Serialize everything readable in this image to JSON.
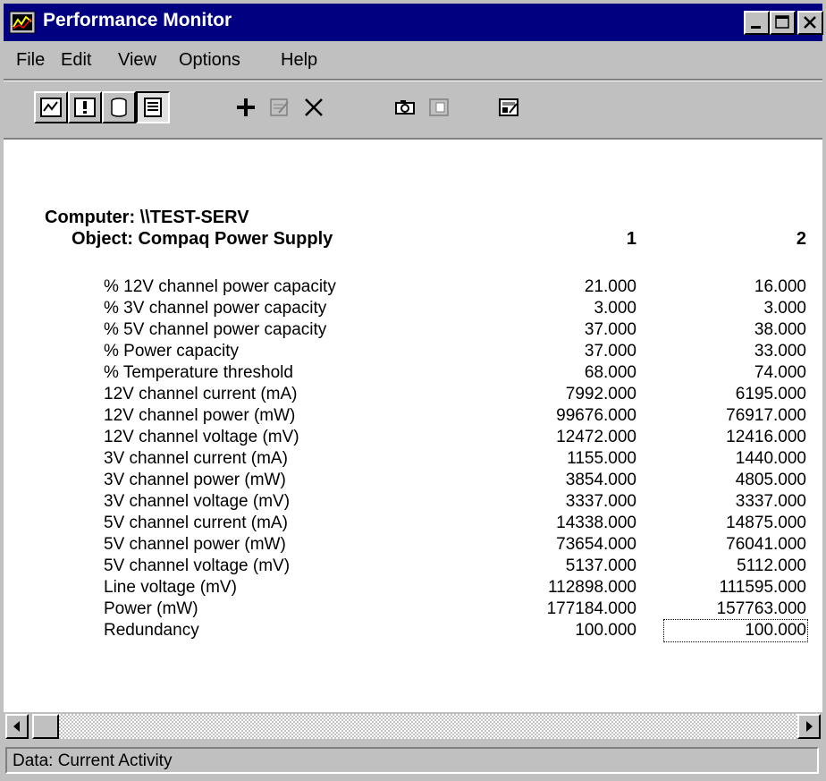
{
  "window": {
    "title": "Performance Monitor"
  },
  "menu": {
    "items": [
      {
        "label": "File"
      },
      {
        "label": "Edit"
      },
      {
        "label": "View"
      },
      {
        "label": "Options"
      },
      {
        "label": "Help"
      }
    ]
  },
  "toolbar": {
    "buttons": [
      "chart-view-icon",
      "alert-view-icon",
      "log-view-icon",
      "report-view-icon",
      "add-icon",
      "edit-icon",
      "delete-icon",
      "camera-icon",
      "export-icon",
      "options-icon"
    ]
  },
  "report": {
    "computer": "Computer: \\\\TEST-SERV",
    "object": "Object: Compaq Power Supply",
    "columns": [
      "1",
      "2"
    ],
    "rows": [
      {
        "label": "% 12V channel power capacity",
        "v1": "21.000",
        "v2": "16.000"
      },
      {
        "label": "% 3V channel power capacity",
        "v1": "3.000",
        "v2": "3.000"
      },
      {
        "label": "% 5V channel power capacity",
        "v1": "37.000",
        "v2": "38.000"
      },
      {
        "label": "% Power capacity",
        "v1": "37.000",
        "v2": "33.000"
      },
      {
        "label": "% Temperature threshold",
        "v1": "68.000",
        "v2": "74.000"
      },
      {
        "label": "12V channel current (mA)",
        "v1": "7992.000",
        "v2": "6195.000"
      },
      {
        "label": "12V channel power (mW)",
        "v1": "99676.000",
        "v2": "76917.000"
      },
      {
        "label": "12V channel voltage (mV)",
        "v1": "12472.000",
        "v2": "12416.000"
      },
      {
        "label": "3V channel current (mA)",
        "v1": "1155.000",
        "v2": "1440.000"
      },
      {
        "label": "3V channel power (mW)",
        "v1": "3854.000",
        "v2": "4805.000"
      },
      {
        "label": "3V channel voltage (mV)",
        "v1": "3337.000",
        "v2": "3337.000"
      },
      {
        "label": "5V channel current (mA)",
        "v1": "14338.000",
        "v2": "14875.000"
      },
      {
        "label": "5V channel power (mW)",
        "v1": "73654.000",
        "v2": "76041.000"
      },
      {
        "label": "5V channel voltage (mV)",
        "v1": "5137.000",
        "v2": "5112.000"
      },
      {
        "label": "Line voltage (mV)",
        "v1": "112898.000",
        "v2": "111595.000"
      },
      {
        "label": "Power (mW)",
        "v1": "177184.000",
        "v2": "157763.000"
      },
      {
        "label": "Redundancy",
        "v1": "100.000",
        "v2": "100.000"
      }
    ]
  },
  "status": {
    "text": "Data: Current Activity"
  }
}
